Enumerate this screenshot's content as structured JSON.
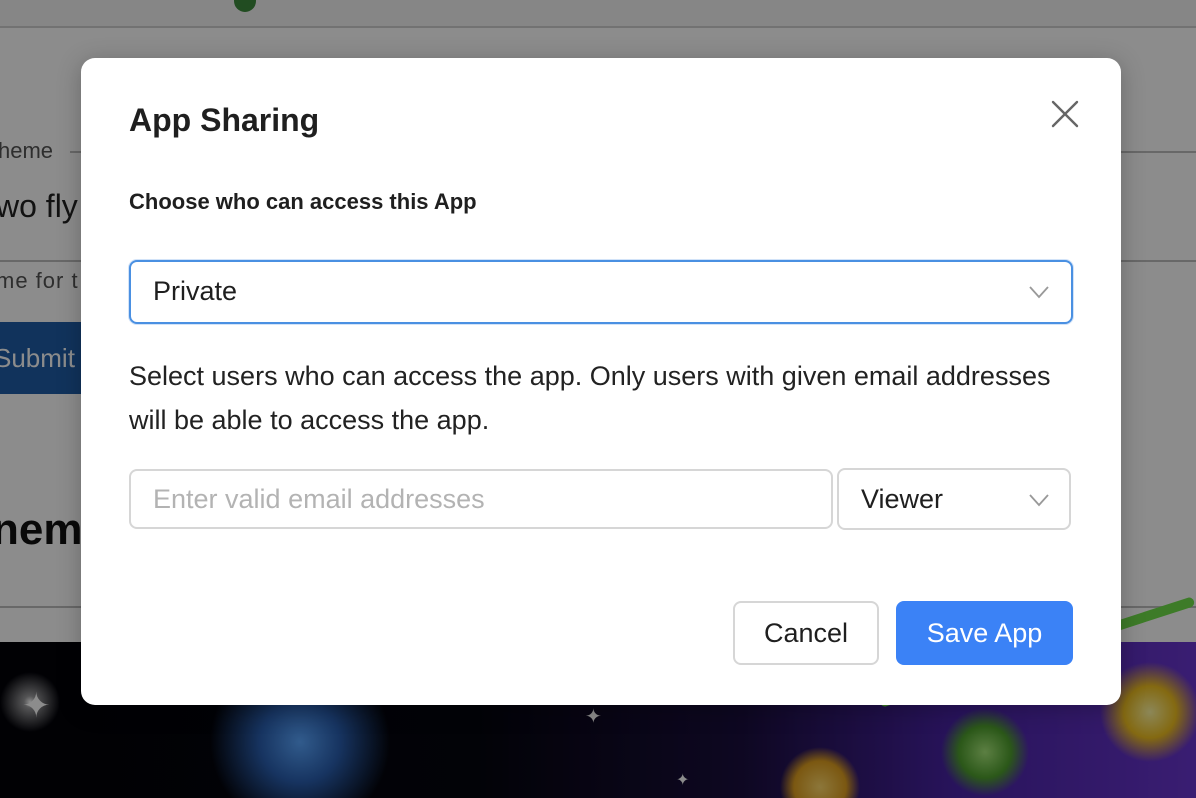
{
  "background": {
    "label_fragment": "heme",
    "title_fragment": "wo fly",
    "hint_fragment": "me for t",
    "submit_fragment": "Submit",
    "heading_fragment": "neme"
  },
  "modal": {
    "title": "App Sharing",
    "close_icon": "close-icon",
    "access_label": "Choose who can access this App",
    "access_select": {
      "value": "Private",
      "icon": "chevron-down-icon"
    },
    "description": "Select users who can access the app. Only users with given email addresses will be able to access the app.",
    "email_input": {
      "value": "",
      "placeholder": "Enter valid email addresses"
    },
    "role_select": {
      "value": "Viewer",
      "icon": "chevron-down-icon"
    },
    "cancel_label": "Cancel",
    "save_label": "Save App"
  },
  "colors": {
    "primary": "#3b82f6",
    "focus_border": "#4a90e2",
    "overlay": "rgba(0,0,0,0.45)"
  }
}
